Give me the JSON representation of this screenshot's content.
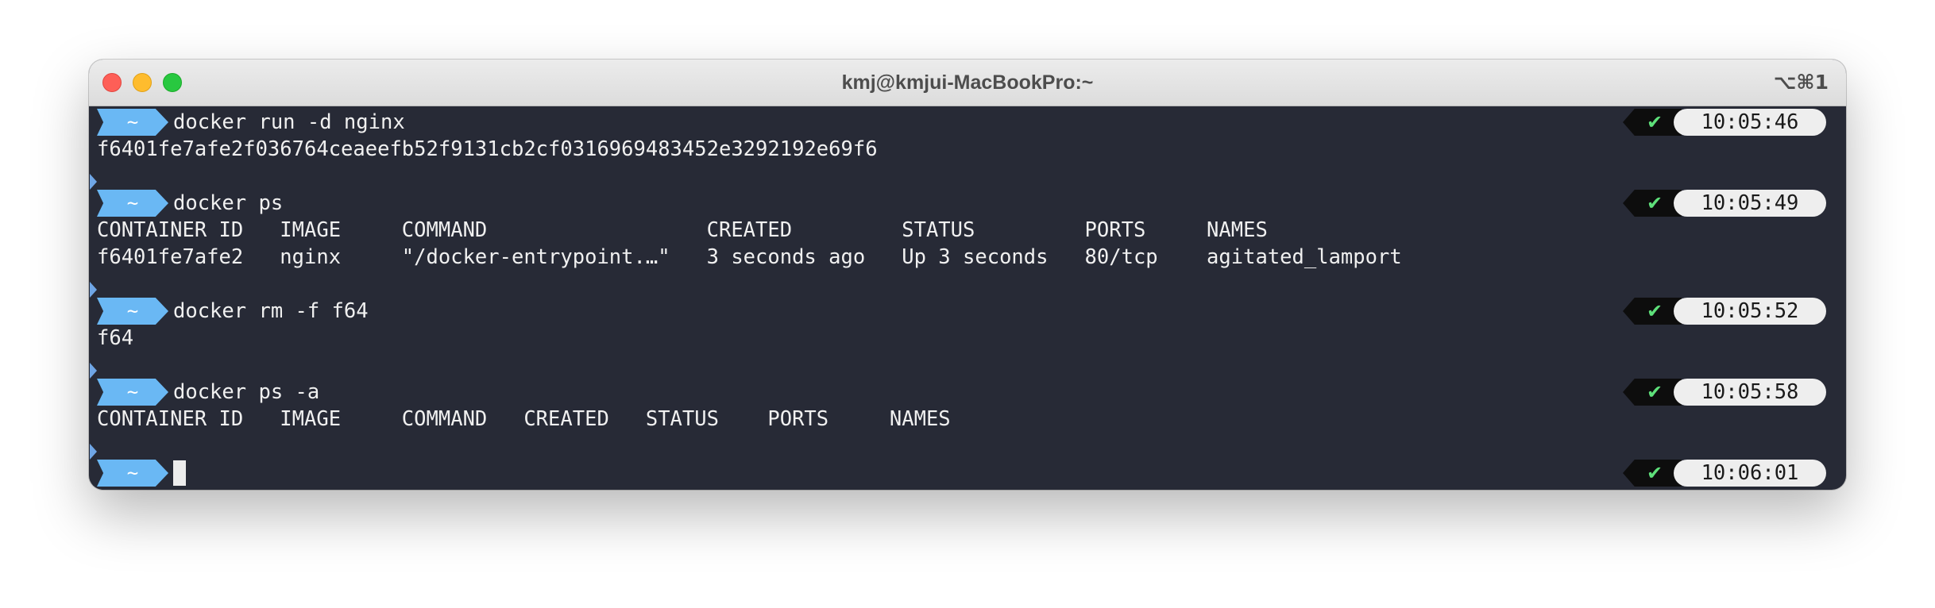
{
  "window": {
    "title": "kmj@kmjui-MacBookPro:~",
    "shortcut": "⌥⌘1"
  },
  "prompt": {
    "dir": "~",
    "status_icon": "✔",
    "prompt_color": "#6ab8f4",
    "success_color": "#5ee07a"
  },
  "blocks": [
    {
      "command": "docker run -d nginx",
      "time": "10:05:46",
      "output": [
        "f6401fe7afe2f036764ceaeefb52f9131cb2cf0316969483452e3292192e69f6"
      ]
    },
    {
      "command": "docker ps",
      "time": "10:05:49",
      "output": [
        "CONTAINER ID   IMAGE     COMMAND                  CREATED         STATUS         PORTS     NAMES",
        "f6401fe7afe2   nginx     \"/docker-entrypoint.…\"   3 seconds ago   Up 3 seconds   80/tcp    agitated_lamport"
      ]
    },
    {
      "command": "docker rm -f f64",
      "time": "10:05:52",
      "output": [
        "f64"
      ]
    },
    {
      "command": "docker ps -a",
      "time": "10:05:58",
      "output": [
        "CONTAINER ID   IMAGE     COMMAND   CREATED   STATUS    PORTS     NAMES"
      ]
    },
    {
      "command": "",
      "time": "10:06:01",
      "output": []
    }
  ]
}
